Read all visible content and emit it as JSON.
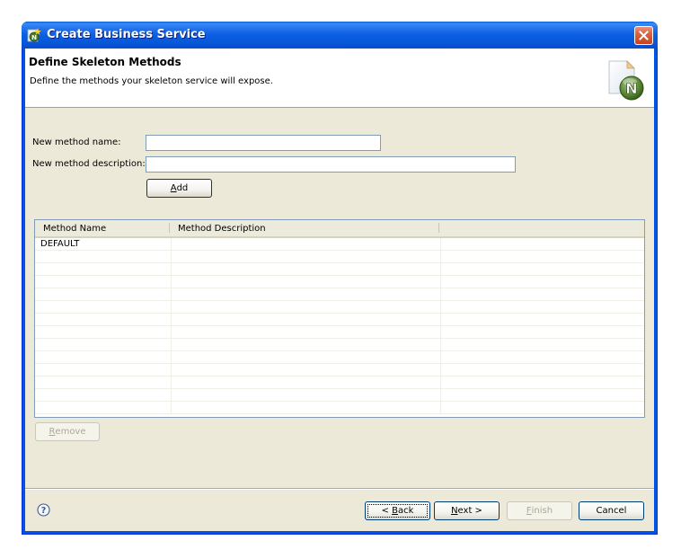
{
  "window": {
    "title": "Create Business Service",
    "icon": "netbeans-new-icon",
    "close_icon": "close-icon"
  },
  "banner": {
    "title": "Define Skeleton Methods",
    "description": "Define the methods your skeleton service will expose.",
    "image": "new-document-n-icon"
  },
  "form": {
    "method_name_label": "New method name:",
    "method_name_value": "",
    "method_description_label": "New method description:",
    "method_description_value": "",
    "add_button": {
      "mnemonic": "A",
      "rest": "dd"
    }
  },
  "table": {
    "columns": [
      "Method Name",
      "Method Description",
      ""
    ],
    "rows": [
      [
        "DEFAULT",
        "",
        ""
      ],
      [
        "",
        "",
        ""
      ],
      [
        "",
        "",
        ""
      ],
      [
        "",
        "",
        ""
      ],
      [
        "",
        "",
        ""
      ],
      [
        "",
        "",
        ""
      ],
      [
        "",
        "",
        ""
      ],
      [
        "",
        "",
        ""
      ],
      [
        "",
        "",
        ""
      ],
      [
        "",
        "",
        ""
      ],
      [
        "",
        "",
        ""
      ],
      [
        "",
        "",
        ""
      ],
      [
        "",
        "",
        ""
      ],
      [
        "",
        "",
        ""
      ]
    ]
  },
  "remove_button": {
    "mnemonic": "R",
    "rest": "emove",
    "enabled": false
  },
  "footer": {
    "help_icon": "help-icon",
    "back_button": {
      "prefix": "< ",
      "mnemonic": "B",
      "rest": "ack"
    },
    "next_button": {
      "mnemonic": "N",
      "rest": "ext >"
    },
    "finish_button": {
      "mnemonic": "F",
      "rest": "inish",
      "enabled": false
    },
    "cancel_button": {
      "label": "Cancel"
    }
  },
  "colors": {
    "titlebar": "#0054e3",
    "client_bg": "#ece9d8",
    "input_border": "#7f9db9",
    "close_button": "#e0603d"
  }
}
